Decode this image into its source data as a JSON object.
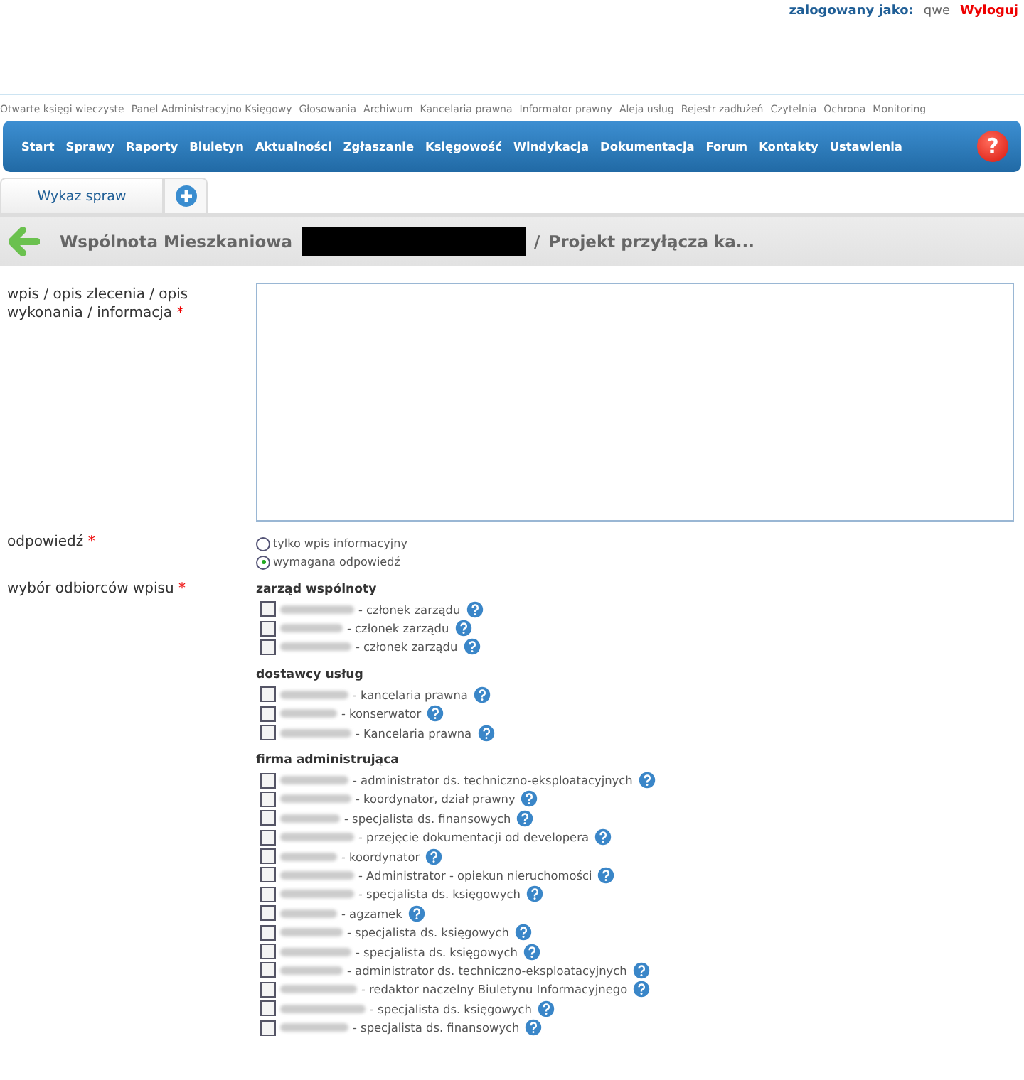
{
  "user_bar": {
    "label": "zalogowany jako:",
    "user": "qwe",
    "logout": "Wyloguj"
  },
  "top_links": [
    "Otwarte księgi wieczyste",
    "Panel Administracyjno Księgowy",
    "Głosowania",
    "Archiwum",
    "Kancelaria prawna",
    "Informator prawny",
    "Aleja usług",
    "Rejestr zadłużeń",
    "Czytelnia",
    "Ochrona",
    "Monitoring"
  ],
  "nav": [
    "Start",
    "Sprawy",
    "Raporty",
    "Biuletyn",
    "Aktualności",
    "Zgłaszanie",
    "Księgowość",
    "Windykacja",
    "Dokumentacja",
    "Forum",
    "Kontakty",
    "Ustawienia"
  ],
  "help_button": "?",
  "tabs": [
    {
      "label": "Wykaz spraw",
      "selected": true
    }
  ],
  "breadcrumb": {
    "community": "Wspólnota Mieszkaniowa",
    "separator": "/",
    "title": "Projekt przyłącza ka..."
  },
  "form": {
    "description_label": "wpis / opis zlecenia / opis wykonania / informacja",
    "required_mark": "*",
    "response_label": "odpowiedź",
    "response_options": [
      {
        "label": "tylko wpis informacyjny",
        "selected": false
      },
      {
        "label": "wymagana odpowiedź",
        "selected": true
      }
    ],
    "recipients_label": "wybór odbiorców wpisu",
    "recipient_groups": [
      {
        "name": "zarząd wspólnoty",
        "members": [
          {
            "role": "- członek zarządu",
            "checked": false
          },
          {
            "role": "- członek zarządu",
            "checked": false
          },
          {
            "role": "- członek zarządu",
            "checked": false
          }
        ]
      },
      {
        "name": "dostawcy usług",
        "members": [
          {
            "role": "- kancelaria prawna",
            "checked": false
          },
          {
            "role": "- konserwator",
            "checked": false
          },
          {
            "role": "- Kancelaria prawna",
            "checked": false
          }
        ]
      },
      {
        "name": "firma administrująca",
        "members": [
          {
            "role": "- administrator ds. techniczno-eksploatacyjnych",
            "checked": false
          },
          {
            "role": "- koordynator, dział prawny",
            "checked": false
          },
          {
            "role": "- specjalista ds. finansowych",
            "checked": false
          },
          {
            "role": "- przejęcie dokumentacji od developera",
            "checked": false
          },
          {
            "role": "- koordynator",
            "checked": false
          },
          {
            "role": "- Administrator - opiekun nieruchomości",
            "checked": false
          },
          {
            "role": "- specjalista ds. księgowych",
            "checked": false
          },
          {
            "role": "- agzamek",
            "checked": false
          },
          {
            "role": "- specjalista ds. księgowych",
            "checked": false
          },
          {
            "role": "- specjalista ds. księgowych",
            "checked": false
          },
          {
            "role": "- administrator ds. techniczno-eksploatacyjnych",
            "checked": false
          },
          {
            "role": "- redaktor naczelny Biuletynu Informacyjnego",
            "checked": false
          },
          {
            "role": "- specjalista ds. księgowych",
            "checked": false
          },
          {
            "role": "- specjalista ds. finansowych",
            "checked": false
          }
        ]
      }
    ]
  }
}
